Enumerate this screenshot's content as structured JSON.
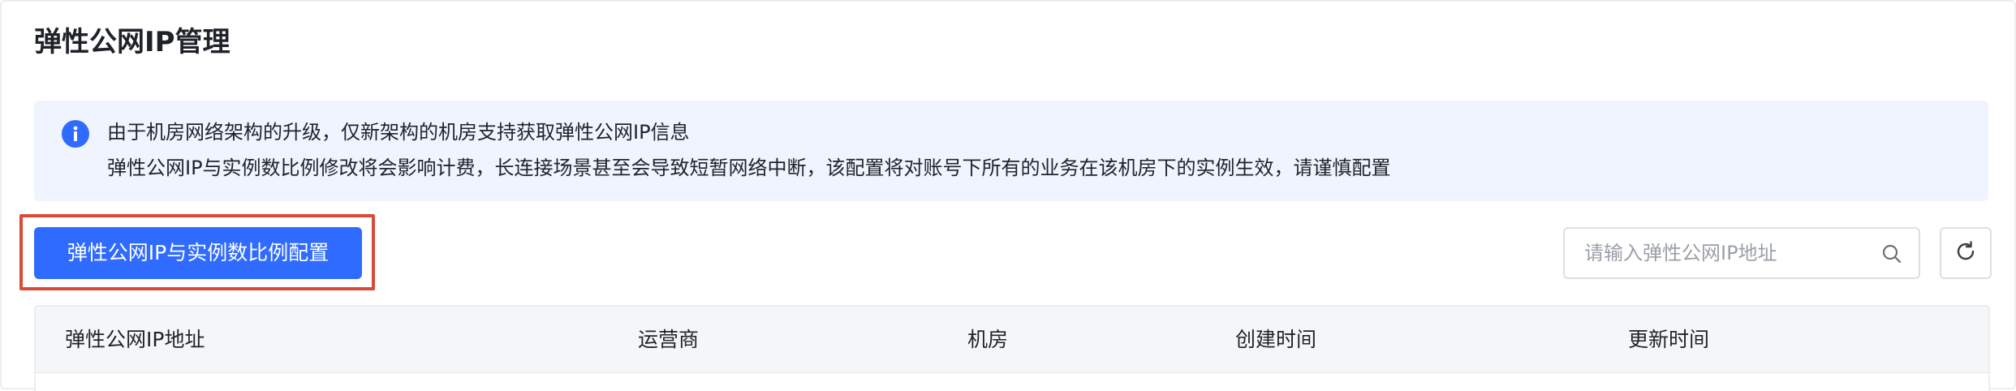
{
  "page": {
    "title": "弹性公网IP管理"
  },
  "notice": {
    "icon": "info-icon",
    "line1": "由于机房网络架构的升级，仅新架构的机房支持获取弹性公网IP信息",
    "line2": "弹性公网IP与实例数比例修改将会影响计费，长连接场景甚至会导致短暂网络中断，该配置将对账号下所有的业务在该机房下的实例生效，请谨慎配置"
  },
  "toolbar": {
    "ratio_config_label": "弹性公网IP与实例数比例配置",
    "search_placeholder": "请输入弹性公网IP地址",
    "search_value": "",
    "search_icon": "search-icon",
    "refresh_icon": "refresh-icon"
  },
  "table": {
    "columns": [
      "弹性公网IP地址",
      "运营商",
      "机房",
      "创建时间",
      "更新时间"
    ]
  },
  "colors": {
    "accent": "#2f6bff",
    "highlight": "#d94a3a",
    "notice_bg": "#f0f4ff",
    "header_bg": "#f5f6f8"
  }
}
